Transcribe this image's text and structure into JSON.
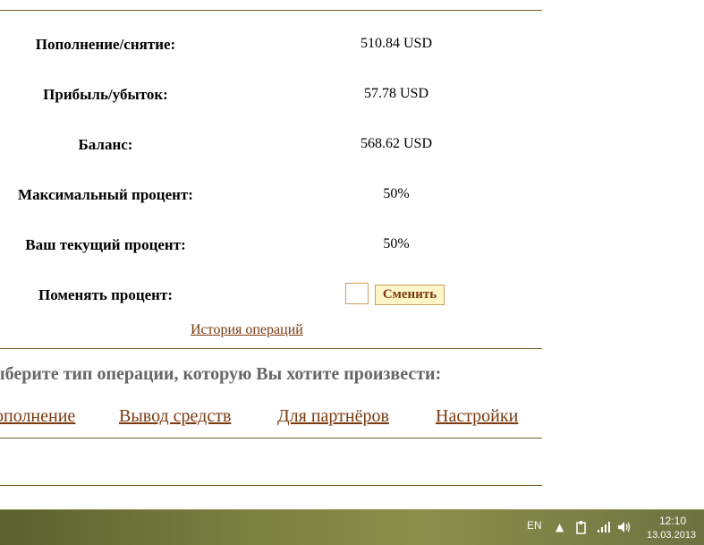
{
  "account": {
    "rows": [
      {
        "label": "Пополнение/снятие:",
        "value": "510.84 USD"
      },
      {
        "label": "Прибыль/убыток:",
        "value": "57.78 USD"
      },
      {
        "label": "Баланс:",
        "value": "568.62 USD"
      },
      {
        "label": "Максимальный процент:",
        "value": "50%"
      },
      {
        "label": "Ваш текущий процент:",
        "value": "50%"
      }
    ],
    "change_percent_label": "Поменять процент:",
    "change_button": "Сменить",
    "history_link": "История операций"
  },
  "operations": {
    "heading": "ыберите тип операции, которую Вы хотите произвести:",
    "links": [
      "ополнение",
      "Вывод средств",
      "Для партнёров",
      "Настройки"
    ]
  },
  "taskbar": {
    "language": "EN",
    "time": "12:10",
    "date": "13.03.2013",
    "icons": [
      "show-hidden-icons-icon",
      "action-center-icon",
      "network-signal-icon",
      "volume-icon"
    ]
  },
  "colors": {
    "divider": "#7a5a2a",
    "link": "#7a3a10",
    "heading": "#666666",
    "button_bg": "#fdf6c8"
  }
}
